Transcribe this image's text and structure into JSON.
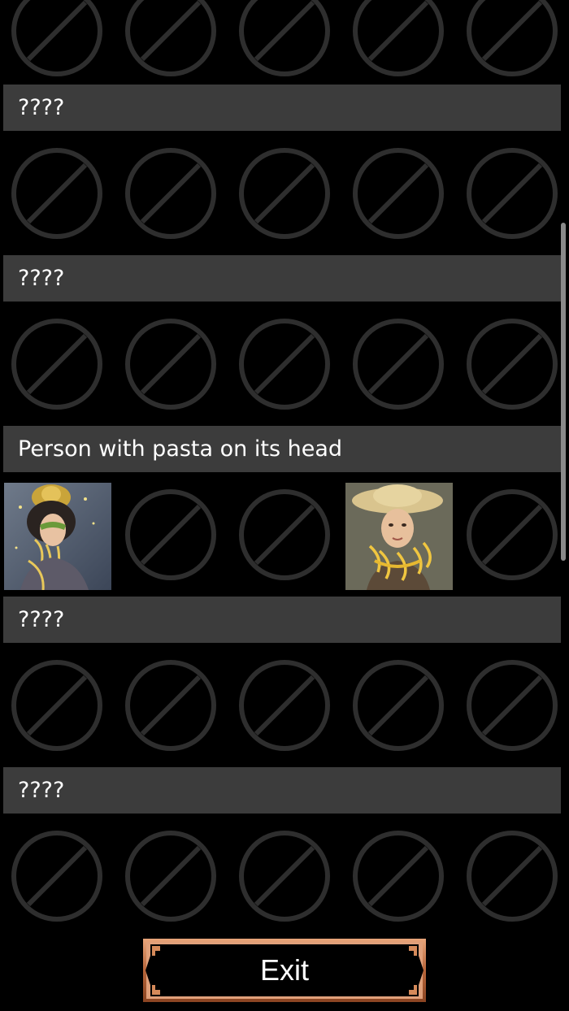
{
  "colors": {
    "background": "#000000",
    "header": "#3c3c3c",
    "locked_icon": "#2e2e2e",
    "button_frame": "#c87a4a"
  },
  "gallery": {
    "top_partial_row": {
      "tiles": [
        "locked",
        "locked",
        "locked",
        "locked",
        "locked"
      ]
    },
    "categories": [
      {
        "title": "????",
        "tiles": [
          "locked",
          "locked",
          "locked",
          "locked",
          "locked"
        ]
      },
      {
        "title": "????",
        "tiles": [
          "locked",
          "locked",
          "locked",
          "locked",
          "locked"
        ]
      },
      {
        "title": "Person with pasta on its head",
        "tiles": [
          "unlocked-woman-masquerade",
          "locked",
          "locked",
          "unlocked-girl-straw-hat",
          "locked"
        ]
      },
      {
        "title": "????",
        "tiles": [
          "locked",
          "locked",
          "locked",
          "locked",
          "locked"
        ]
      },
      {
        "title": "????",
        "tiles": [
          "locked",
          "locked",
          "locked",
          "locked",
          "locked"
        ]
      }
    ]
  },
  "icons": {
    "locked": "prohibited-circle-icon"
  },
  "exit_button": {
    "label": "Exit"
  }
}
